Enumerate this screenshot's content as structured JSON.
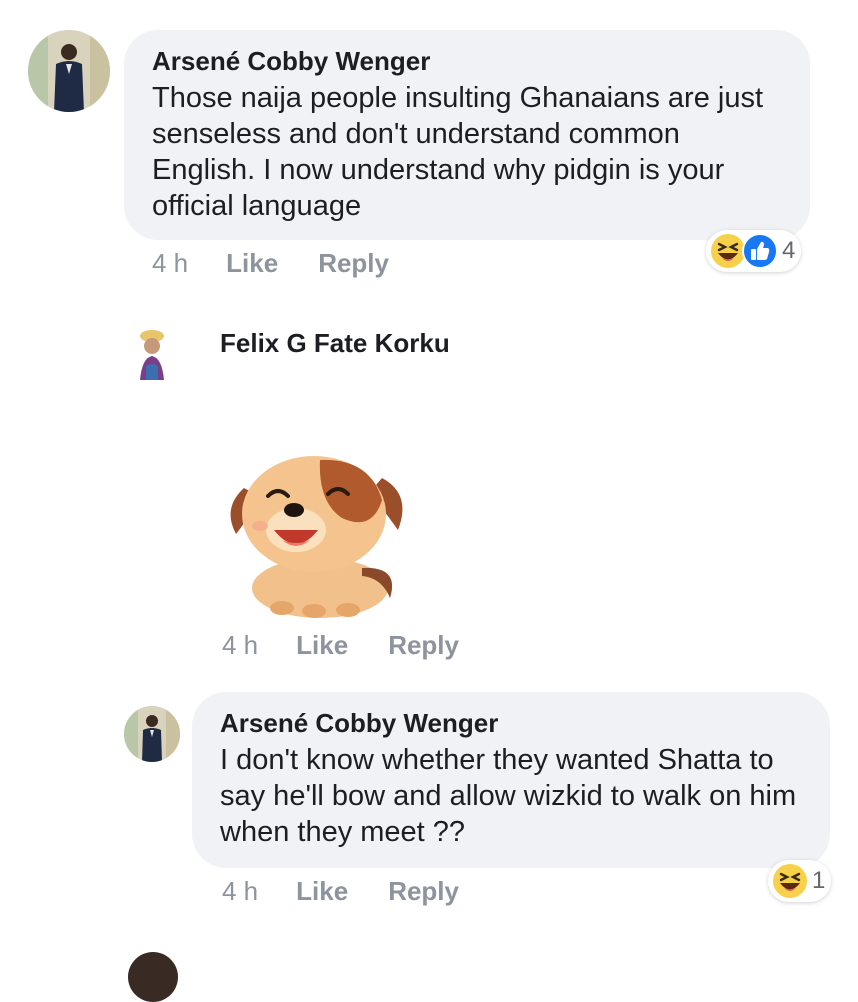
{
  "comments": [
    {
      "author": "Arsené Cobby Wenger",
      "text": "Those naija people insulting Ghanaians are just senseless and don't understand common English. I now understand why pidgin is your official language",
      "time": "4 h",
      "like_label": "Like",
      "reply_label": "Reply",
      "reaction_icons": [
        "haha-icon",
        "like-icon"
      ],
      "reaction_count": "4"
    },
    {
      "author": "Felix G Fate Korku",
      "sticker": "puppy-sticker",
      "time": "4 h",
      "like_label": "Like",
      "reply_label": "Reply"
    },
    {
      "author": "Arsené Cobby Wenger",
      "text": "I don't know whether they wanted Shatta to say he'll bow and allow wizkid to walk on him when they meet ??",
      "time": "4 h",
      "like_label": "Like",
      "reply_label": "Reply",
      "reaction_icons": [
        "haha-icon"
      ],
      "reaction_count": "1"
    }
  ],
  "colors": {
    "bubble": "#f0f2f5",
    "meta": "#8d949e",
    "like_blue": "#1877f2",
    "haha_yellow": "#f7d14a"
  }
}
